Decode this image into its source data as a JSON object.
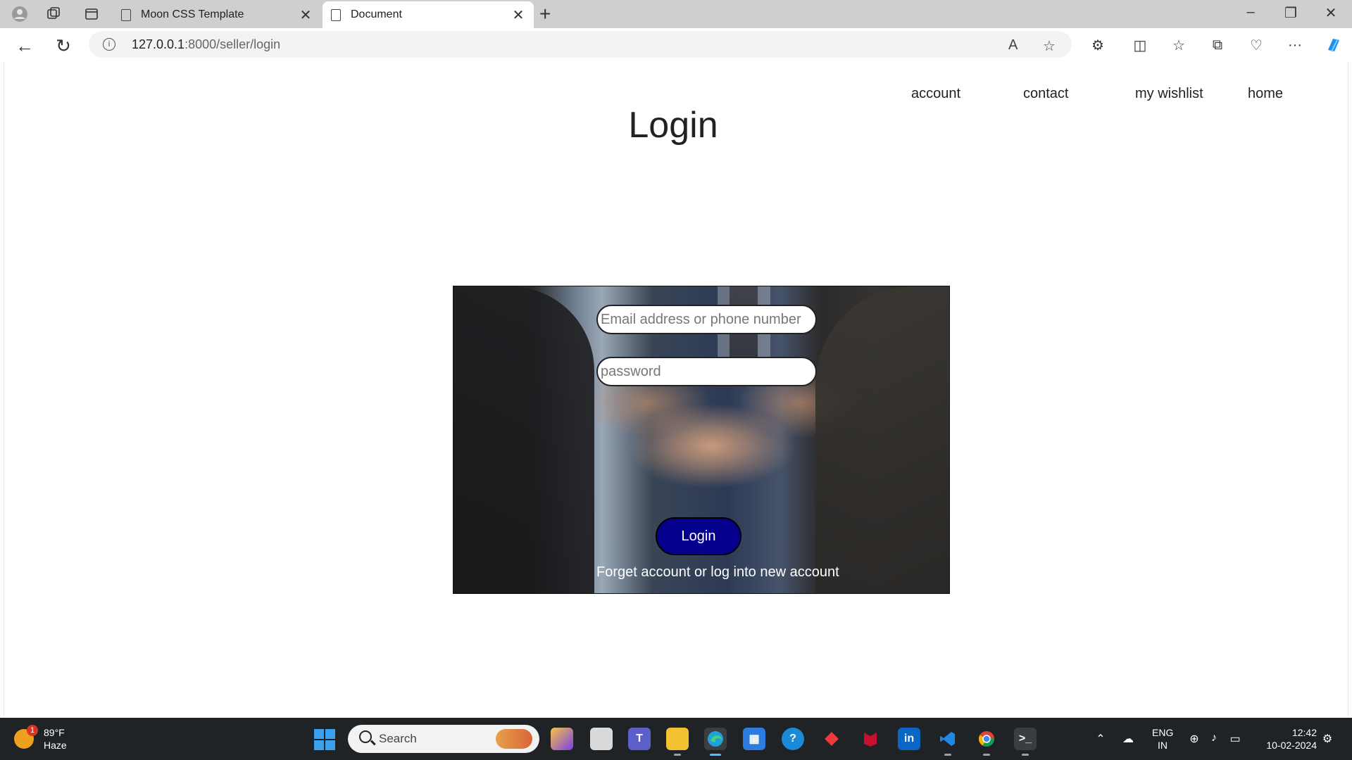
{
  "browser": {
    "tabs": [
      {
        "title": "Moon CSS Template"
      },
      {
        "title": "Document"
      }
    ],
    "address": {
      "host": "127.0.0.1",
      "path": ":8000/seller/login"
    }
  },
  "site": {
    "nav": [
      "account",
      "contact",
      "my wishlist",
      "home"
    ],
    "title": "Login",
    "form": {
      "email_placeholder": "Email address or phone number",
      "password_placeholder": "password",
      "submit_label": "Login",
      "forget_text": "Forget account or log into new account"
    }
  },
  "taskbar": {
    "weather": {
      "temp": "89°F",
      "condition": "Haze",
      "badge": "1"
    },
    "search_label": "Search",
    "language": [
      "ENG",
      "IN"
    ],
    "clock": {
      "time": "12:42",
      "date": "10-02-2024"
    }
  },
  "colors": {
    "login_button": "#05008c",
    "accent": "#0078d4"
  }
}
